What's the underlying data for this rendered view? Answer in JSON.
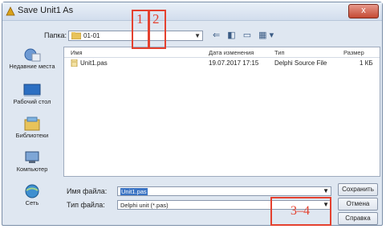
{
  "window": {
    "title": "Save Unit1 As",
    "close_label": "x"
  },
  "path_bar": {
    "label": "Папка:",
    "value": "01-01",
    "arrow": "▼",
    "tools": "⇐ ◧ ▭ ▦▾"
  },
  "places": [
    {
      "icon": "recent-places-icon",
      "label": "Недавние места"
    },
    {
      "icon": "desktop-icon",
      "label": "Рабочий стол"
    },
    {
      "icon": "libraries-icon",
      "label": "Библиотеки"
    },
    {
      "icon": "computer-icon",
      "label": "Компьютер"
    },
    {
      "icon": "network-icon",
      "label": "Сеть"
    }
  ],
  "file_list": {
    "columns": [
      "Имя",
      "Дата изменения",
      "Тип",
      "Размер"
    ],
    "rows": [
      {
        "name": "Unit1.pas",
        "date": "19.07.2017 17:15",
        "type": "Delphi Source File",
        "size": "1 КБ"
      }
    ]
  },
  "filename": {
    "label": "Имя файла:",
    "value": "Unit1.pas",
    "arrow": "▼"
  },
  "filetype": {
    "label": "Тип файла:",
    "value": "Delphi unit (*.pas)",
    "arrow": "▼"
  },
  "buttons": {
    "save": "Сохранить",
    "cancel": "Отмена",
    "help": "Справка"
  },
  "annotations": {
    "mark1": "1",
    "mark2": "2",
    "mark3": "3–4"
  },
  "colors": {
    "annotation": "#e4412f",
    "selection": "#3b74c4",
    "window_bg": "#dfe7f1"
  }
}
